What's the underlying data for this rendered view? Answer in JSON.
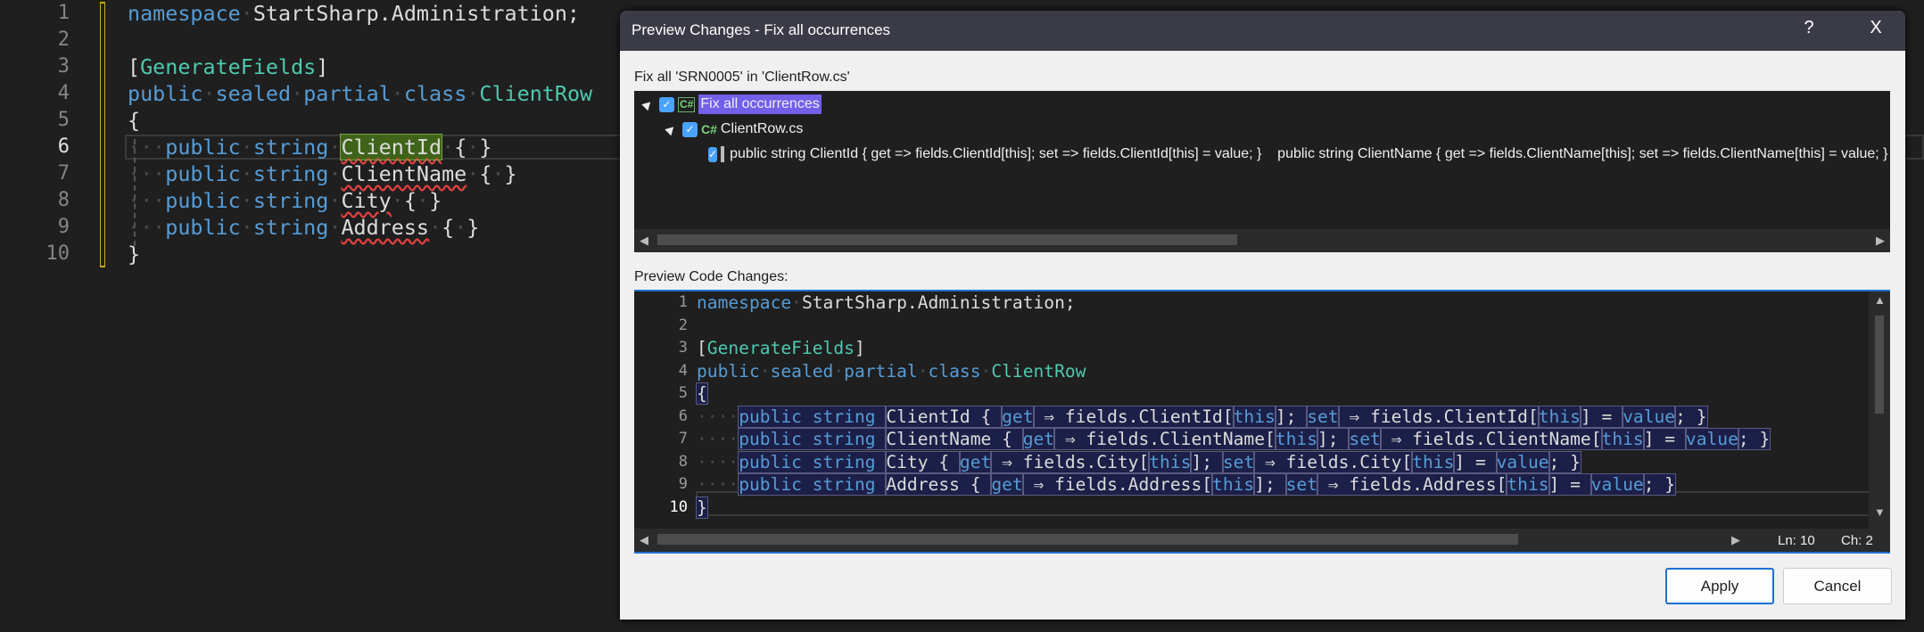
{
  "editor": {
    "current_line": 6,
    "lines": [
      {
        "n": "1",
        "tokens": [
          [
            "namespace",
            "k"
          ],
          [
            "·",
            "w"
          ],
          [
            "StartSharp.Administration;",
            "p"
          ]
        ]
      },
      {
        "n": "2",
        "tokens": []
      },
      {
        "n": "3",
        "tokens": [
          [
            "[",
            "p"
          ],
          [
            "GenerateFields",
            "t"
          ],
          [
            "]",
            "p"
          ]
        ]
      },
      {
        "n": "4",
        "tokens": [
          [
            "public",
            "k"
          ],
          [
            "·",
            "w"
          ],
          [
            "sealed",
            "k"
          ],
          [
            "·",
            "w"
          ],
          [
            "partial",
            "k"
          ],
          [
            "·",
            "w"
          ],
          [
            "class",
            "k"
          ],
          [
            "·",
            "w"
          ],
          [
            "ClientRow",
            "t"
          ]
        ]
      },
      {
        "n": "5",
        "tokens": [
          [
            "{",
            "p"
          ]
        ]
      },
      {
        "n": "6",
        "tokens": [
          [
            "···",
            "w"
          ],
          [
            "public",
            "k"
          ],
          [
            "·",
            "w"
          ],
          [
            "string",
            "k"
          ],
          [
            "·",
            "w"
          ],
          [
            "ClientId",
            "p e h"
          ],
          [
            "·",
            "w"
          ],
          [
            "{",
            "p"
          ],
          [
            "·",
            "w"
          ],
          [
            "}",
            "p"
          ]
        ]
      },
      {
        "n": "7",
        "tokens": [
          [
            "···",
            "w"
          ],
          [
            "public",
            "k"
          ],
          [
            "·",
            "w"
          ],
          [
            "string",
            "k"
          ],
          [
            "·",
            "w"
          ],
          [
            "ClientName",
            "p e"
          ],
          [
            "·",
            "w"
          ],
          [
            "{",
            "p"
          ],
          [
            "·",
            "w"
          ],
          [
            "}",
            "p"
          ]
        ]
      },
      {
        "n": "8",
        "tokens": [
          [
            "···",
            "w"
          ],
          [
            "public",
            "k"
          ],
          [
            "·",
            "w"
          ],
          [
            "string",
            "k"
          ],
          [
            "·",
            "w"
          ],
          [
            "City",
            "p e"
          ],
          [
            "·",
            "w"
          ],
          [
            "{",
            "p"
          ],
          [
            "·",
            "w"
          ],
          [
            "}",
            "p"
          ]
        ]
      },
      {
        "n": "9",
        "tokens": [
          [
            "···",
            "w"
          ],
          [
            "public",
            "k"
          ],
          [
            "·",
            "w"
          ],
          [
            "string",
            "k"
          ],
          [
            "·",
            "w"
          ],
          [
            "Address",
            "p e"
          ],
          [
            "·",
            "w"
          ],
          [
            "{",
            "p"
          ],
          [
            "·",
            "w"
          ],
          [
            "}",
            "p"
          ]
        ]
      },
      {
        "n": "10",
        "tokens": [
          [
            "}",
            "p"
          ]
        ]
      }
    ]
  },
  "dialog": {
    "title": "Preview Changes - Fix all occurrences",
    "help_label": "?",
    "close_label": "X",
    "fix_label": "Fix all 'SRN0005' in 'ClientRow.cs'",
    "tree": {
      "root": {
        "label": "Fix all occurrences",
        "checked": true,
        "icon": "csharp-project-icon"
      },
      "file": {
        "label": "ClientRow.cs",
        "checked": true,
        "icon": "csharp-file-icon"
      },
      "change": {
        "label": "public string ClientId { get => fields.ClientId[this]; set => fields.ClientId[this] = value; }    public string ClientName { get => fields.ClientName[this]; set => fields.ClientName[this] = value; }    public string City { get => fields.City[this]; set => fields.City[this] = value; }",
        "checked": true,
        "icon": "code-change-icon"
      }
    },
    "preview_label": "Preview Code Changes:",
    "preview": {
      "current_line": 10,
      "lines": [
        {
          "n": "1",
          "tokens": [
            [
              "namespace",
              "k"
            ],
            [
              "·",
              "w"
            ],
            [
              "StartSharp.Administration;",
              "p"
            ]
          ]
        },
        {
          "n": "2",
          "tokens": []
        },
        {
          "n": "3",
          "tokens": [
            [
              "[",
              "p"
            ],
            [
              "GenerateFields",
              "t"
            ],
            [
              "]",
              "p"
            ]
          ]
        },
        {
          "n": "4",
          "tokens": [
            [
              "public",
              "k"
            ],
            [
              "·",
              "w"
            ],
            [
              "sealed",
              "k"
            ],
            [
              "·",
              "w"
            ],
            [
              "partial",
              "k"
            ],
            [
              "·",
              "w"
            ],
            [
              "class",
              "k"
            ],
            [
              "·",
              "w"
            ],
            [
              "ClientRow",
              "t"
            ]
          ]
        },
        {
          "n": "5",
          "tokens": [
            [
              "{",
              "p sel"
            ]
          ]
        },
        {
          "n": "6",
          "tokens": [
            [
              "····",
              "w"
            ],
            [
              "public string ",
              "k sel"
            ],
            [
              "ClientId { ",
              "p sel"
            ],
            [
              "get",
              "k sel"
            ],
            [
              " ⇒ fields.ClientId[",
              "p sel"
            ],
            [
              "this",
              "k sel"
            ],
            [
              "]; ",
              "p sel"
            ],
            [
              "set",
              "k sel"
            ],
            [
              " ⇒ fields.ClientId[",
              "p sel"
            ],
            [
              "this",
              "k sel"
            ],
            [
              "] = ",
              "p sel"
            ],
            [
              "value",
              "k sel"
            ],
            [
              "; }",
              "p sel"
            ]
          ]
        },
        {
          "n": "7",
          "tokens": [
            [
              "····",
              "w"
            ],
            [
              "public string ",
              "k sel"
            ],
            [
              "ClientName { ",
              "p sel"
            ],
            [
              "get",
              "k sel"
            ],
            [
              " ⇒ fields.ClientName[",
              "p sel"
            ],
            [
              "this",
              "k sel"
            ],
            [
              "]; ",
              "p sel"
            ],
            [
              "set",
              "k sel"
            ],
            [
              " ⇒ fields.ClientName[",
              "p sel"
            ],
            [
              "this",
              "k sel"
            ],
            [
              "] = ",
              "p sel"
            ],
            [
              "value",
              "k sel"
            ],
            [
              "; }",
              "p sel"
            ]
          ]
        },
        {
          "n": "8",
          "tokens": [
            [
              "····",
              "w"
            ],
            [
              "public string ",
              "k sel"
            ],
            [
              "City { ",
              "p sel"
            ],
            [
              "get",
              "k sel"
            ],
            [
              " ⇒ fields.City[",
              "p sel"
            ],
            [
              "this",
              "k sel"
            ],
            [
              "]; ",
              "p sel"
            ],
            [
              "set",
              "k sel"
            ],
            [
              " ⇒ fields.City[",
              "p sel"
            ],
            [
              "this",
              "k sel"
            ],
            [
              "] = ",
              "p sel"
            ],
            [
              "value",
              "k sel"
            ],
            [
              "; }",
              "p sel"
            ]
          ]
        },
        {
          "n": "9",
          "tokens": [
            [
              "····",
              "w"
            ],
            [
              "public string ",
              "k sel"
            ],
            [
              "Address { ",
              "p sel"
            ],
            [
              "get",
              "k sel"
            ],
            [
              " ⇒ fields.Address[",
              "p sel"
            ],
            [
              "this",
              "k sel"
            ],
            [
              "]; ",
              "p sel"
            ],
            [
              "set",
              "k sel"
            ],
            [
              " ⇒ fields.Address[",
              "p sel"
            ],
            [
              "this",
              "k sel"
            ],
            [
              "] = ",
              "p sel"
            ],
            [
              "value",
              "k sel"
            ],
            [
              "; }",
              "p sel"
            ]
          ]
        },
        {
          "n": "10",
          "tokens": [
            [
              "}",
              "p sel"
            ]
          ]
        }
      ],
      "status_line": "Ln: 10",
      "status_char": "Ch: 2"
    },
    "apply_label": "Apply",
    "cancel_label": "Cancel"
  },
  "colors": {
    "keyword": "#569cd6",
    "type": "#4ec9b0",
    "selection": "#7160e8",
    "accent": "#1f6fd0"
  }
}
